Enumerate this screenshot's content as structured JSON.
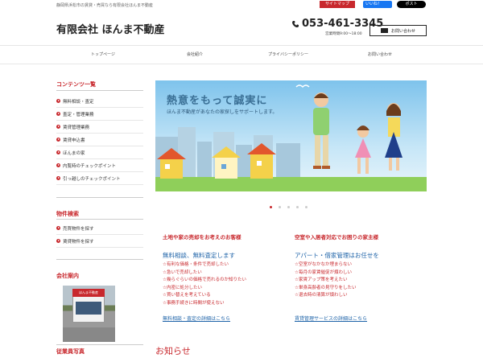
{
  "header": {
    "tagline": "静岡県浜松市の賃貸・売買なら有限会社ほんま不動産",
    "sitemap": "サイトマップ",
    "fb_like": "いいね！",
    "x_post": "ポスト",
    "company_name": "有限会社 ほんま不動産",
    "phone": "053-461-3345",
    "hours": "営業時間9:00～18:00",
    "contact": "お問い合わせ"
  },
  "nav": {
    "items": [
      "トップページ",
      "会社紹介",
      "プライバシーポリシー",
      "お問い合わせ"
    ]
  },
  "sidebar": {
    "contents_title": "コンテンツ一覧",
    "contents": [
      "無料相談・査定",
      "査定・管理業務",
      "賃貸管理業務",
      "賃貸申込書",
      "ほんまの家",
      "内覧時のチェックポイント",
      "引っ越しのチェックポイント"
    ],
    "search_title": "物件検索",
    "search": [
      "売買物件を探す",
      "賃貸物件を探す"
    ],
    "company_title": "会社案内",
    "store_sign": "ほんま不動産",
    "staff_title": "従業員写真"
  },
  "banner": {
    "line1": "熱意をもって誠実に",
    "line2": "ほんま不動産があなたの家探しをサポートします。"
  },
  "left_col": {
    "heading": "土地や家の売却をお考えのお客様",
    "sub": "無料相談、無料査定します",
    "items": [
      "有利な価格・条件で売却したい",
      "急いで売却したい",
      "幾らぐらいの価格で売れるのか知りたい",
      "内密に処分したい",
      "買い替えを考えている",
      "事務手続きに時間が使えない"
    ],
    "link": "無料相談・査定の詳細はこちら"
  },
  "right_col": {
    "heading": "空室や入居者対応でお困りの家主様",
    "sub": "アパート・借家管理はお任せを",
    "items": [
      "空室がなかなか埋まらない",
      "毎月の家賃催促が煩わしい",
      "家賃アップ策を考えたい",
      "単身高齢者の見守りをしたい",
      "退去時の清算が煩わしい"
    ],
    "link": "賃貸管理サービスの詳細はこちら"
  },
  "news": {
    "title": "お知らせ"
  },
  "colors": {
    "accent_red": "#c8282d",
    "link_blue": "#1e63a8"
  }
}
